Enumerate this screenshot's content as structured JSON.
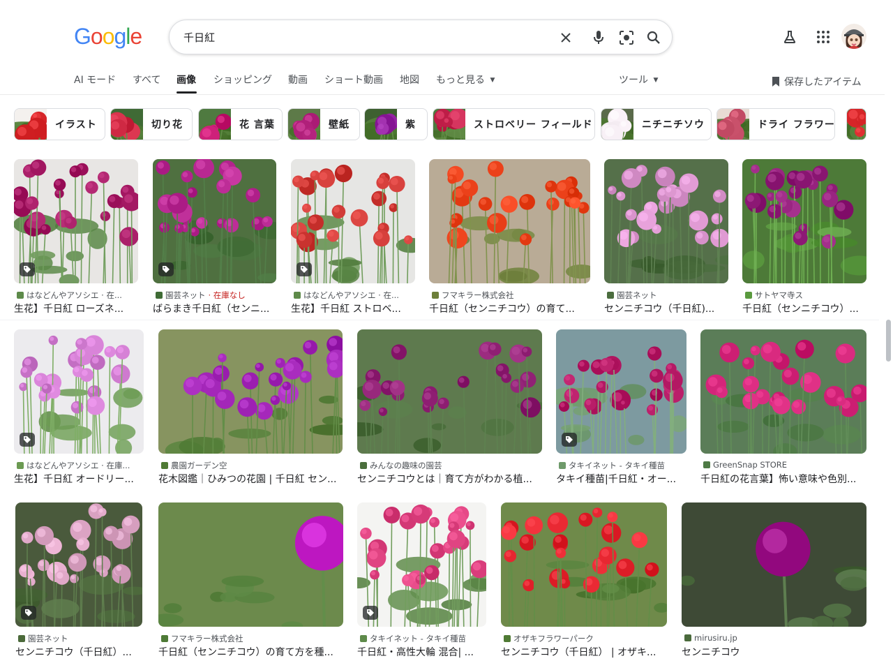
{
  "header": {
    "logo_letters": [
      "G",
      "o",
      "o",
      "g",
      "l",
      "e"
    ],
    "logo_colors": [
      "#4285F4",
      "#EA4335",
      "#FBBC05",
      "#4285F4",
      "#34A853",
      "#EA4335"
    ],
    "search": {
      "value": "千日紅",
      "placeholder": ""
    },
    "icons": {
      "clear": "close-icon",
      "voice": "microphone-icon",
      "lens": "camera-lens-icon",
      "search": "search-icon",
      "labs": "flask-icon",
      "apps": "apps-grid-icon",
      "account": "avatar"
    }
  },
  "tabs": [
    {
      "label": "AI モード"
    },
    {
      "label": "すべて"
    },
    {
      "label": "画像",
      "active": true
    },
    {
      "label": "ショッピング"
    },
    {
      "label": "動画"
    },
    {
      "label": "ショート動画"
    },
    {
      "label": "地図"
    },
    {
      "label": "もっと見る"
    }
  ],
  "tools_label": "ツール",
  "saved_label": "保存したアイテム",
  "chips": [
    {
      "label": "イラスト"
    },
    {
      "label": "切り花"
    },
    {
      "label": "花 言葉"
    },
    {
      "label": "壁紙"
    },
    {
      "label": "紫"
    },
    {
      "label": "ストロベリー フィールド"
    },
    {
      "label": "ニチニチソウ"
    },
    {
      "label": "ドライ フラワー"
    }
  ],
  "results": [
    {
      "source": "はなどんやアソシエ · 在...",
      "title": "生花】千日紅 ローズネ...",
      "flower_color": "#a0155f",
      "bg": "#e8e6e4",
      "leaf": "#5d8a4a",
      "has_tag": true
    },
    {
      "source": "園芸ネット",
      "stock": "· 在庫なし",
      "title": "ばらまき千日紅（センニ...",
      "flower_color": "#b0208a",
      "bg": "#4f7040",
      "leaf": "#3f6b35",
      "has_tag": true
    },
    {
      "source": "はなどんやアソシエ · 在...",
      "title": "生花】千日紅 ストロベ...",
      "flower_color": "#c8322e",
      "bg": "#e6e6e4",
      "leaf": "#5e8a4a",
      "has_tag": true
    },
    {
      "source": "フマキラー株式会社",
      "title": "千日紅（センニチコウ）の育て...",
      "flower_color": "#e53b14",
      "bg": "#b9ab96",
      "leaf": "#6d7f3a",
      "has_tag": false
    },
    {
      "source": "園芸ネット",
      "title": "センニチコウ（千日紅)...",
      "flower_color": "#d58fc8",
      "bg": "#55704a",
      "leaf": "#4b6d3e",
      "has_tag": false
    },
    {
      "source": "サトヤマ寺ス",
      "title": "千日紅（センニチコウ）...",
      "flower_color": "#8c1874",
      "bg": "#4d7a38",
      "leaf": "#5a9a3e",
      "has_tag": false
    },
    {
      "source": "はなどんやアソシエ · 在庫...",
      "title": "生花】千日紅 オードリー...",
      "flower_color": "#c873c8",
      "bg": "#ecebee",
      "leaf": "#6b9a52",
      "has_tag": true
    },
    {
      "source": "農園ガーデン空",
      "title": "花木図鑑｜ひみつの花園 | 千日紅 セン...",
      "flower_color": "#9b1eb0",
      "bg": "#879460",
      "leaf": "#4f7a34",
      "has_tag": false
    },
    {
      "source": "みんなの趣味の園芸",
      "title": "センニチコウとは｜育て方がわかる植...",
      "flower_color": "#8a1a6e",
      "bg": "#5e7a4e",
      "leaf": "#4a6e3c",
      "has_tag": false
    },
    {
      "source": "タキイネット - タキイ種苗",
      "title": "タキイ種苗|千日紅・オー...",
      "flower_color": "#b01560",
      "bg": "#7d9aa0",
      "leaf": "#6e9a6a",
      "has_tag": true
    },
    {
      "source": "GreenSnap STORE",
      "title": "千日紅の花言葉】怖い意味や色別...",
      "flower_color": "#c8196e",
      "bg": "#5b7d58",
      "leaf": "#4e7a45",
      "has_tag": false
    },
    {
      "source": "園芸ネット",
      "title": "センニチコウ（千日紅）...",
      "flower_color": "#d8a0c0",
      "bg": "#4a5a3c",
      "leaf": "#4b6a3a",
      "has_tag": true
    },
    {
      "source": "フマキラー株式会社",
      "title": "千日紅（センニチコウ）の育て方を種...",
      "flower_color": "#c41ec8",
      "bg": "#6c8a4c",
      "leaf": "#4e7a36",
      "has_tag": false
    },
    {
      "source": "タキイネット - タキイ種苗",
      "title": "千日紅・高性大輪 混合| ...",
      "flower_color": "#d63a78",
      "bg": "#f4f4f2",
      "leaf": "#5e8a4a",
      "has_tag": true
    },
    {
      "source": "オザキフラワーパーク",
      "title": "センニチコウ（千日紅） | オザキ...",
      "flower_color": "#e0202a",
      "bg": "#6f8a4a",
      "leaf": "#4f7a34",
      "has_tag": false
    },
    {
      "source": "mirusiru.jp",
      "title": "センニチコウ",
      "flower_color": "#a0168c",
      "bg": "#3e4a36",
      "leaf": "#4a6a3c",
      "has_tag": false
    }
  ],
  "colors": {
    "accent": "#1a73e8",
    "text": "#202124",
    "muted": "#4d5156",
    "stock_red": "#c5221f"
  }
}
